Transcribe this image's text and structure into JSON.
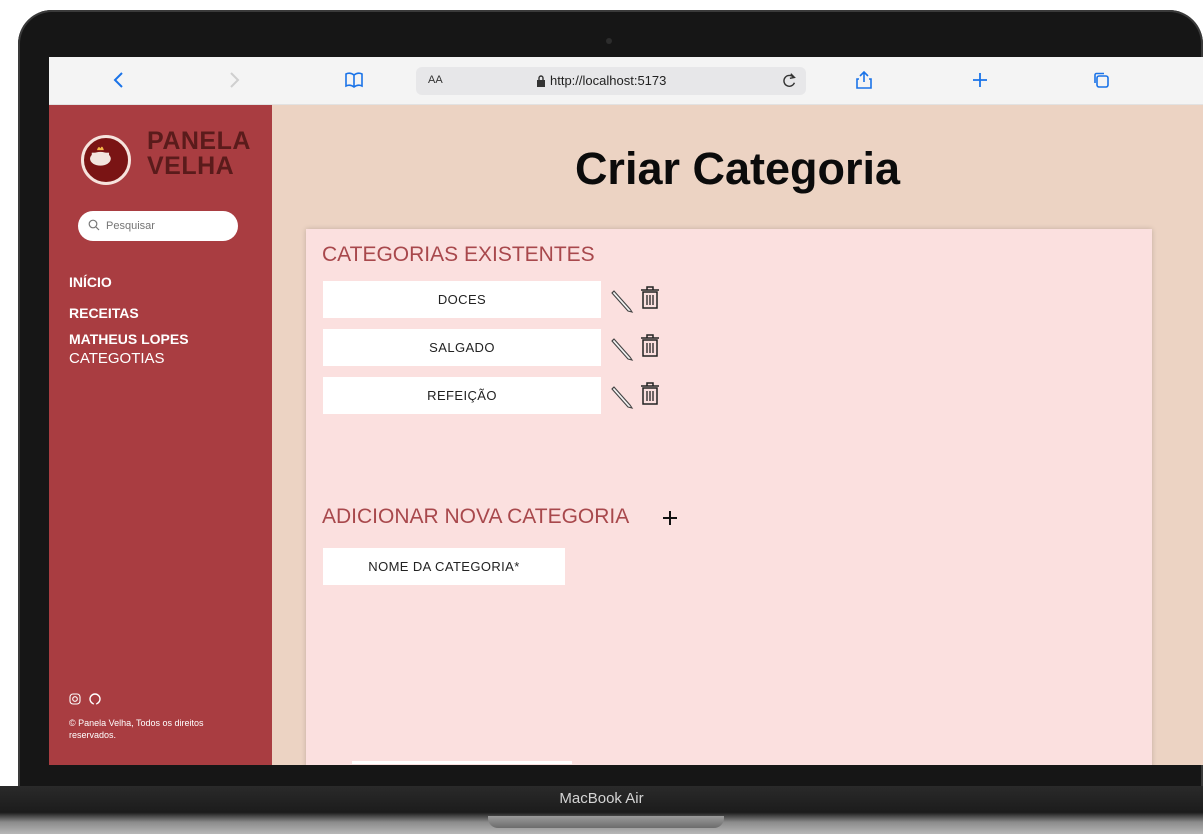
{
  "device": {
    "label": "MacBook Air"
  },
  "browser": {
    "url": "http://localhost:5173",
    "text_size_label": "AA",
    "icons": [
      "back-icon",
      "forward-icon",
      "bookmarks-icon",
      "lock-icon",
      "reload-icon",
      "share-icon",
      "new-tab-icon",
      "tabs-icon"
    ]
  },
  "sidebar": {
    "brand_line1": "PANELA",
    "brand_line2": "VELHA",
    "search_placeholder": "Pesquisar",
    "nav": [
      {
        "label": "INÍCIO"
      },
      {
        "label": "RECEITAS"
      },
      {
        "label": "MATHEUS LOPES"
      },
      {
        "label": "CATEGOTIAS"
      }
    ],
    "social_icons": [
      "instagram-icon",
      "github-icon"
    ],
    "copyright": "© Panela Velha, Todos os direitos reservados."
  },
  "main": {
    "title": "Criar Categoria",
    "existing_title": "CATEGORIAS EXISTENTES",
    "categories": [
      {
        "name": "DOCES"
      },
      {
        "name": "SALGADO"
      },
      {
        "name": "REFEIÇÃO"
      }
    ],
    "add_title": "ADICIONAR NOVA CATEGORIA",
    "add_icon": "plus-icon",
    "new_category_placeholder": "NOME DA CATEGORIA*"
  },
  "colors": {
    "sidebar_bg": "#a93d41",
    "page_bg": "#ecd3c3",
    "card_bg": "#fbe0df",
    "section_title": "#a8484c",
    "brand_text": "#5a1b1b"
  }
}
